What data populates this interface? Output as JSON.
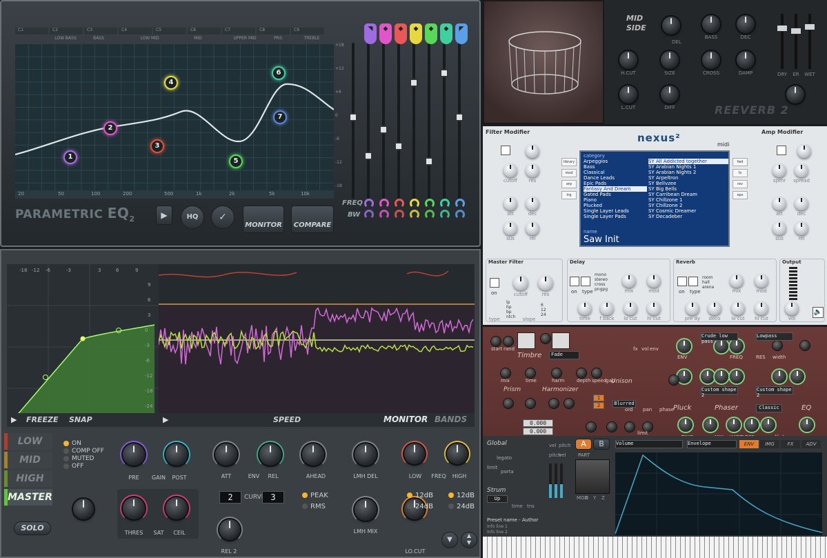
{
  "eq": {
    "title_a": "PARAMETRIC ",
    "title_b": "EQ",
    "title_sub": "2",
    "bands": [
      "C1",
      "C2",
      "C3",
      "C4",
      "C5",
      "C6",
      "C7",
      "C8",
      "C9"
    ],
    "band_names": [
      "LOW BASS",
      "BASS",
      "LOW MID",
      "MID",
      "UPPER MID",
      "PRS",
      "TREBLE"
    ],
    "db_ticks": [
      "+18",
      "+12",
      "+6",
      "0",
      "-6",
      "-12",
      "-18"
    ],
    "freq_ticks": [
      "20",
      "50",
      "100",
      "200",
      "500",
      "1k",
      "2k",
      "5k",
      "10k"
    ],
    "nodes": [
      {
        "label": "1",
        "color": "#b069e0"
      },
      {
        "label": "2",
        "color": "#e056c8"
      },
      {
        "label": "3",
        "color": "#e0503a"
      },
      {
        "label": "4",
        "color": "#e8e040"
      },
      {
        "label": "5",
        "color": "#58d858"
      },
      {
        "label": "6",
        "color": "#40d0a0"
      },
      {
        "label": "7",
        "color": "#5a86d8"
      }
    ],
    "band_colors": [
      "#9e6be0",
      "#e056c8",
      "#e85858",
      "#e8d840",
      "#58d858",
      "#40d0a0",
      "#5aa0e8"
    ],
    "freq_label": "FREQ",
    "bw_label": "BW",
    "hq_label": "HQ",
    "monitor_label": "MONITOR",
    "compare_label": "COMPARE"
  },
  "reverb": {
    "title": "REEVERB 2",
    "mid_side": "MID SIDE",
    "knobs": [
      "H.CUT",
      "SIZE",
      "L.CUT",
      "DIFF",
      "BASS",
      "DEC",
      "CROSS",
      "DAMP"
    ],
    "del_label": "DEL",
    "faders": [
      "DRY",
      "ER",
      "WET"
    ]
  },
  "nexus": {
    "logo": "nexus²",
    "filter_title": "Filter Modifier",
    "amp_title": "Amp Modifier",
    "midi_label": "midi",
    "categories_header": "category",
    "categories": [
      "Arpeggios",
      "Bass",
      "Classical",
      "Dance Leads",
      "Epic Pads",
      "Fantasy And Dream",
      "Gated Pads",
      "Piano",
      "Plucked",
      "Single Layer Leads",
      "Single Layer Pads"
    ],
    "presets": [
      "SY All Addicted together",
      "SY Arabian Nights 1",
      "SY Arabian Nights 2",
      "SY Arpeltron",
      "SY Bellvzee",
      "SY Big Bells",
      "SY Carribean Dream",
      "SY Chillzone 1",
      "SY Chillzone 2",
      "SY Cosmic Dreamer",
      "SY Decadeber"
    ],
    "name_header": "name",
    "preset_name": "Saw Init",
    "side_tabs": [
      "library",
      "mod",
      "arp",
      "trg"
    ],
    "right_tabs": [
      "fwd",
      "fx",
      "rev",
      "eps"
    ],
    "filter_knob_labels": [
      "cutoff",
      "res",
      "att",
      "dec",
      "sus",
      "rel"
    ],
    "amp_knob_labels": [
      "spthr",
      "spread",
      "att",
      "dec",
      "sus",
      "rel"
    ],
    "on_label": "on",
    "sections": {
      "master_filter": "Master Filter",
      "delay": "Delay",
      "reverb": "Reverb",
      "output": "Output"
    },
    "mf_types": [
      "lp",
      "hp",
      "bp",
      "ntch"
    ],
    "slope_vals": [
      "6",
      "12",
      "24"
    ],
    "mf_labels": [
      "cutoff",
      "res",
      "type",
      "slope"
    ],
    "delay_modes": [
      "mono",
      "stereo",
      "cross",
      "pngpg"
    ],
    "delay_labels": [
      "type",
      "mix",
      "mod",
      "time",
      "f back",
      "lo cut",
      "hi cut"
    ],
    "rev_modes": [
      "room",
      "hall",
      "arena"
    ],
    "rev_labels": [
      "type",
      "mix",
      "mod",
      "pre dy",
      "deco",
      "lo cut",
      "hi cut"
    ],
    "vol_label": "vol"
  },
  "harmor": {
    "timbre": "Timbre",
    "fade_label": "Fade",
    "harmonizer": "Harmonizer",
    "prism": "Prism",
    "unison": "Unison",
    "pluck": "Pluck",
    "phaser": "Phaser",
    "eq_label": "EQ",
    "filter1": "Crude low pass",
    "filter2": "Lowpass",
    "shape1": "Custom shape 2",
    "shape2": "Custom shape 2",
    "blend_mode": "Blurred",
    "phaser_mode": "Classic",
    "pitch_vals": [
      "0.000",
      "0.000"
    ],
    "harm_vals": [
      "1",
      "2"
    ],
    "labels": [
      "start",
      "rand",
      "mix",
      "time",
      "harm",
      "depth",
      "speed",
      "gap",
      "ENV",
      "FREQ",
      "RES",
      "width",
      "mix",
      "MIX",
      "WIDTH",
      "OFS",
      "speed",
      "ifs.l",
      "TIME",
      "fx",
      "vol",
      "env",
      "adapt",
      "ord",
      "pan",
      "phase",
      "mod",
      "depth",
      "speed",
      "time",
      "limit",
      "pitch",
      "detune",
      "uni",
      "speed",
      "ofs",
      "fz",
      "blur",
      "AMT",
      "str",
      "on"
    ],
    "global": "Global",
    "legato": "legato",
    "porta": "porta",
    "limit": "limit",
    "strum": "Strum",
    "strum_mode": "Up",
    "strum_labels": [
      "time",
      "tns"
    ],
    "part": "PART",
    "part_a": "A",
    "part_b": "B",
    "env_target": "Volume",
    "env_type": "Envelope",
    "env_tabs": [
      "ENV",
      "IMG",
      "FX",
      "ADV"
    ],
    "preset_name": "Preset name - Author",
    "info1": "Info line 1",
    "info2": "Info line 2",
    "mod_xy": [
      "MOD",
      "X",
      "Y",
      "Z"
    ],
    "vel_labels": [
      "vel",
      "pitch",
      "pitch",
      "vel",
      "mod",
      "pit",
      "pres",
      "pitch"
    ]
  },
  "maximus": {
    "db_left": [
      "-18",
      "-12",
      "-6",
      "-3",
      "3",
      "6",
      "9"
    ],
    "db_right": [
      "9",
      "6",
      "3",
      "0",
      "-3",
      "-6",
      "-12",
      "-18",
      "-24"
    ],
    "freeze": "FREEZE",
    "snap": "SNAP",
    "speed": "SPEED",
    "monitor": "MONITOR",
    "bands": "BANDS",
    "band_tabs": [
      "LOW",
      "MID",
      "HIGH",
      "MASTER"
    ],
    "modes": [
      "ON",
      "COMP OFF",
      "MUTED",
      "OFF"
    ],
    "solo": "SOLO",
    "knobs1": [
      "PRE",
      "GAIN",
      "POST"
    ],
    "knobs2": [
      "THRES",
      "SAT",
      "CEIL"
    ],
    "knobs3": [
      "ATT",
      "ENV",
      "REL",
      "AHEAD"
    ],
    "curve_a": "2",
    "curve_label": "CURVE",
    "curve_b": "3",
    "peak": "PEAK",
    "rms": "RMS",
    "rel2": "REL 2",
    "lmh_del": "LMH DEL",
    "lmh_mix": "LMH MIX",
    "xover": [
      "LOW",
      "FREQ",
      "HIGH"
    ],
    "slopes": [
      "12dB",
      "24dB",
      "12dB",
      "24dB"
    ],
    "locut": "LO.CUT",
    "colors": {
      "low": "#a84036",
      "mid": "#a0813a",
      "high": "#6a8a3a",
      "master": "#68c048"
    }
  }
}
